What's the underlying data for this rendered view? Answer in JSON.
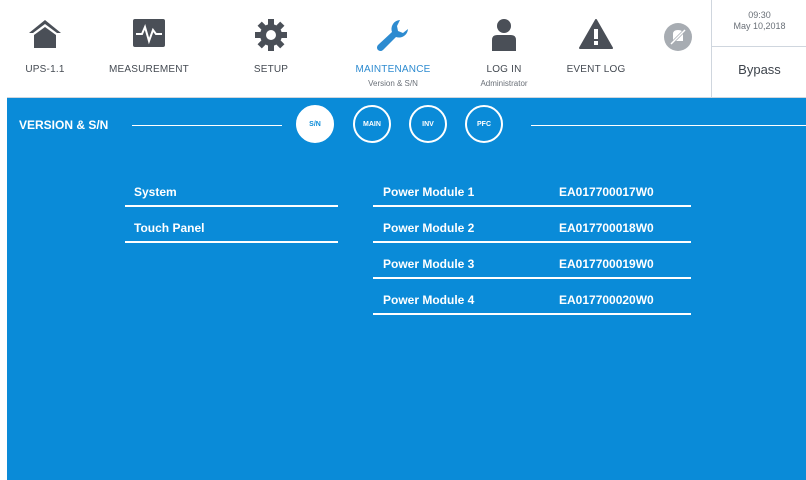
{
  "nav": {
    "ups": {
      "label": "UPS-1.1",
      "icon": "home-icon"
    },
    "measurement": {
      "label": "MEASUREMENT",
      "icon": "pulse-monitor-icon"
    },
    "setup": {
      "label": "SETUP",
      "icon": "gear-icon"
    },
    "maintenance": {
      "label": "MAINTENANCE",
      "sublabel": "Version & S/N",
      "icon": "wrench-icon",
      "active": true
    },
    "login": {
      "label": "LOG IN",
      "sublabel": "Administrator",
      "icon": "user-icon"
    },
    "eventlog": {
      "label": "EVENT LOG",
      "icon": "warning-icon"
    },
    "mute": {
      "icon": "mute-icon"
    }
  },
  "status": {
    "time": "09:30",
    "date": "May 10,2018",
    "mode": "Bypass"
  },
  "page": {
    "title": "VERSION & S/N",
    "tabs": [
      {
        "label": "S/N",
        "active": true
      },
      {
        "label": "MAIN",
        "active": false
      },
      {
        "label": "INV",
        "active": false
      },
      {
        "label": "PFC",
        "active": false
      }
    ]
  },
  "left_rows": [
    {
      "label": "System"
    },
    {
      "label": "Touch Panel"
    }
  ],
  "modules": [
    {
      "label": "Power Module 1",
      "serial": "EA017700017W0"
    },
    {
      "label": "Power Module 2",
      "serial": "EA017700018W0"
    },
    {
      "label": "Power Module 3",
      "serial": "EA017700019W0"
    },
    {
      "label": "Power Module 4",
      "serial": "EA017700020W0"
    }
  ],
  "colors": {
    "accent_blue": "#0a8bd8",
    "active_nav_text": "#2d8bd0",
    "icon_gray": "#4a4f57"
  }
}
